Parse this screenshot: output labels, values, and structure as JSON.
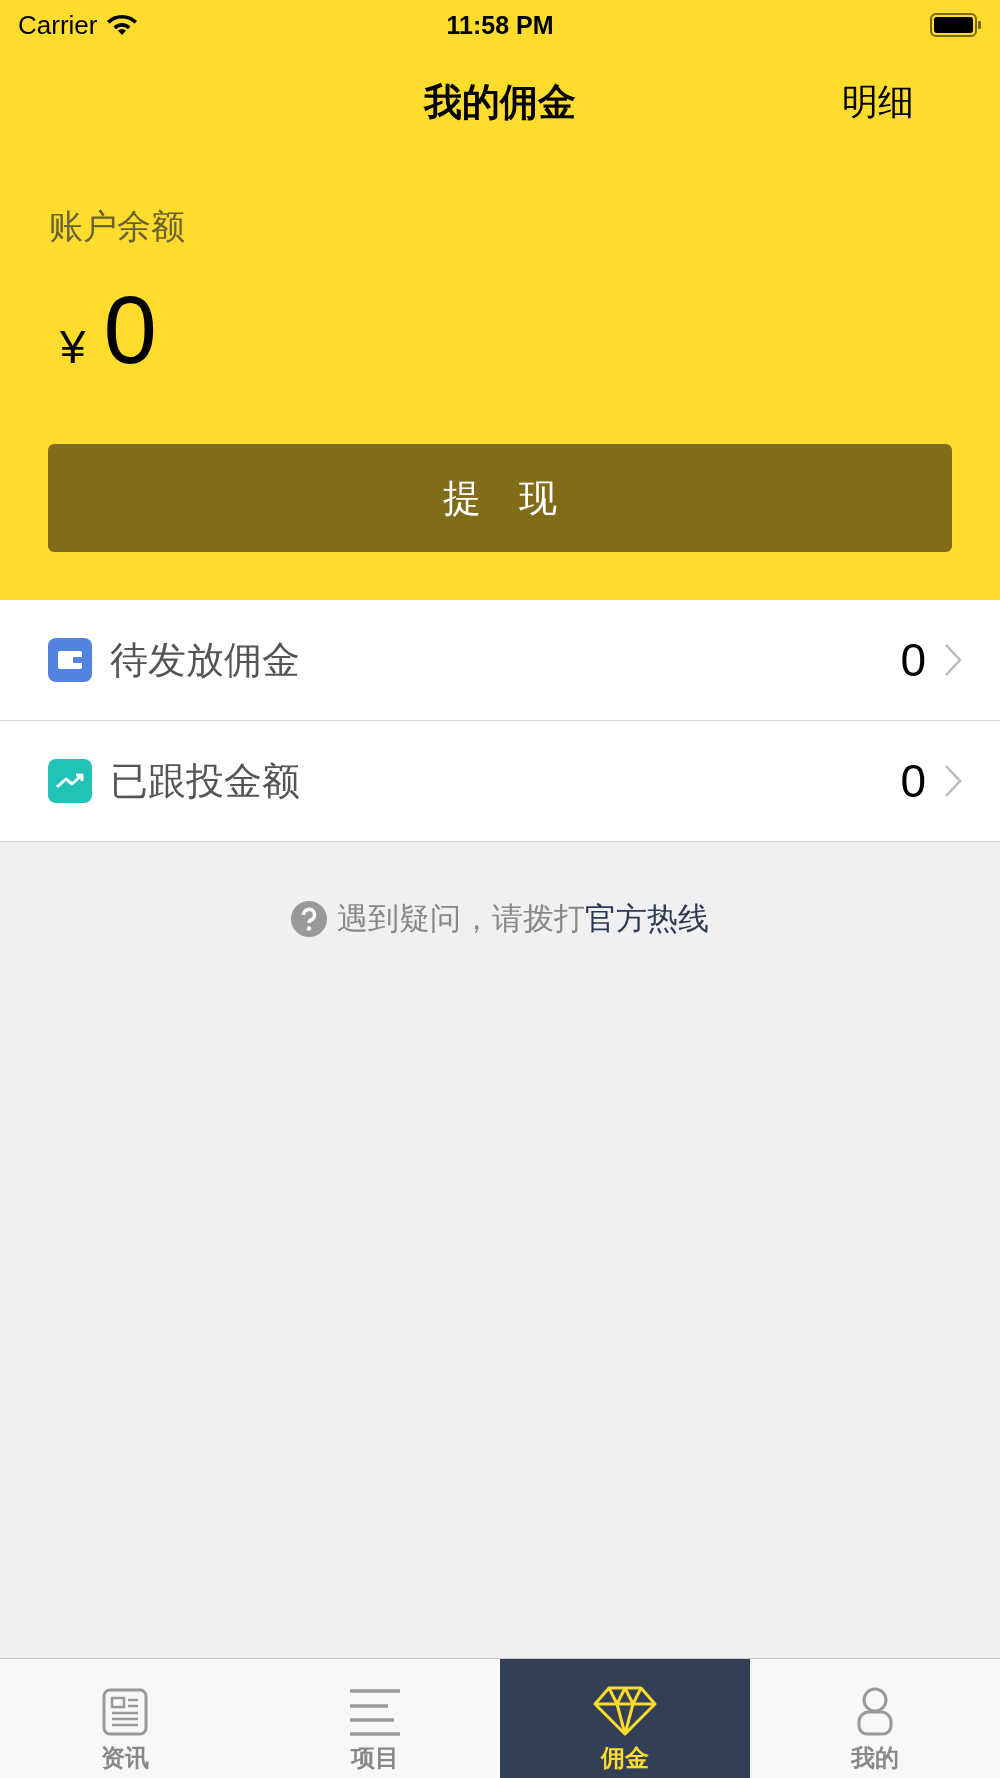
{
  "status_bar": {
    "carrier": "Carrier",
    "time": "11:58 PM"
  },
  "nav": {
    "title": "我的佣金",
    "action": "明细"
  },
  "balance": {
    "label": "账户余额",
    "currency": "¥",
    "amount": "0",
    "button": "提　现"
  },
  "rows": [
    {
      "label": "待发放佣金",
      "value": "0"
    },
    {
      "label": "已跟投金额",
      "value": "0"
    }
  ],
  "help": {
    "text": "遇到疑问，请拨打",
    "link": "官方热线"
  },
  "tabs": [
    {
      "label": "资讯",
      "selected": false
    },
    {
      "label": "项目",
      "selected": false
    },
    {
      "label": "佣金",
      "selected": true
    },
    {
      "label": "我的",
      "selected": false
    }
  ]
}
